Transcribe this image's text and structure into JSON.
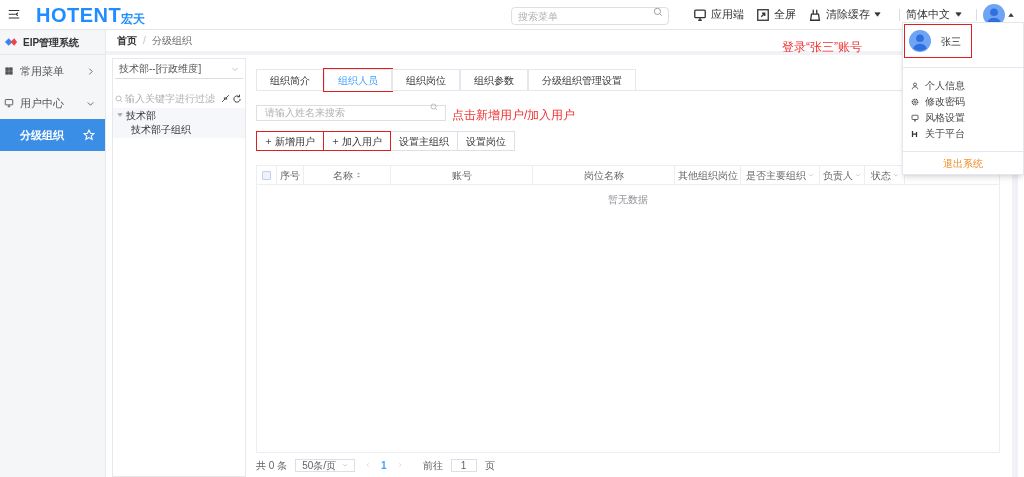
{
  "header": {
    "logo_latin": "HOTENT",
    "logo_cjk": "宏天",
    "search": {
      "placeholder": "搜索菜单"
    },
    "actions": [
      {
        "kind": "monitor",
        "label": "应用端",
        "dropdown": false
      },
      {
        "kind": "fullscreen",
        "label": "全屏",
        "dropdown": false
      },
      {
        "kind": "clean",
        "label": "清除缓存",
        "dropdown": true
      }
    ],
    "language": "简体中文"
  },
  "sidebar": {
    "system": "EIP管理系统",
    "items": [
      {
        "kind": "grid",
        "label": "常用菜单",
        "expanded": false,
        "selected": false
      },
      {
        "kind": "monitor",
        "label": "用户中心",
        "expanded": true,
        "selected": false
      },
      {
        "kind": "child",
        "label": "分级组织",
        "selected": true
      }
    ]
  },
  "breadcrumb": {
    "items": [
      "首页",
      "分级组织"
    ],
    "separator": "/"
  },
  "org_panel": {
    "dimension": "技术部--[行政维度]",
    "filter_placeholder": "输入关键字进行过滤",
    "tree": [
      {
        "label": "技术部",
        "expanded": true,
        "children": [
          {
            "label": "技术部子组织"
          }
        ]
      }
    ]
  },
  "tabs": [
    {
      "label": "组织简介",
      "selected": false,
      "highlighted": false
    },
    {
      "label": "组织人员",
      "selected": true,
      "highlighted": true
    },
    {
      "label": "组织岗位",
      "selected": false,
      "highlighted": false
    },
    {
      "label": "组织参数",
      "selected": false,
      "highlighted": false
    },
    {
      "label": "分级组织管理设置",
      "selected": false,
      "highlighted": false
    }
  ],
  "member_search": {
    "placeholder": "请输入姓名来搜索"
  },
  "buttons": [
    {
      "label": "新增用户",
      "plus": true,
      "highlighted": true
    },
    {
      "label": "加入用户",
      "plus": true,
      "highlighted": true
    },
    {
      "label": "设置主组织",
      "plus": false,
      "highlighted": false
    },
    {
      "label": "设置岗位",
      "plus": false,
      "highlighted": false
    }
  ],
  "table": {
    "select_all_checked": false,
    "columns": [
      {
        "label": "序号"
      },
      {
        "label": "名称",
        "sortable": true
      },
      {
        "label": "账号"
      },
      {
        "label": "岗位名称"
      },
      {
        "label": "其他组织岗位"
      },
      {
        "label": "是否主要组织",
        "filter": true
      },
      {
        "label": "负责人",
        "filter": true
      },
      {
        "label": "状态",
        "filter": true
      }
    ],
    "empty_text": "暂无数据"
  },
  "pagination": {
    "total": "共 0 条",
    "page_size": "50条/页",
    "current_page": "1",
    "goto_label": "前往",
    "goto_value": "1",
    "page_suffix": "页"
  },
  "user_menu": {
    "name": "张三",
    "highlighted": true,
    "items": [
      {
        "kind": "user",
        "label": "个人信息"
      },
      {
        "kind": "gear",
        "label": "修改密码"
      },
      {
        "kind": "monitor",
        "label": "风格设置"
      },
      {
        "kind": "logo",
        "label": "关于平台"
      }
    ],
    "logout": "退出系统"
  },
  "annotations": [
    {
      "kind": "login",
      "text": "登录“张三”账号"
    },
    {
      "kind": "click",
      "text": "点击新增用户/加入用户"
    }
  ]
}
